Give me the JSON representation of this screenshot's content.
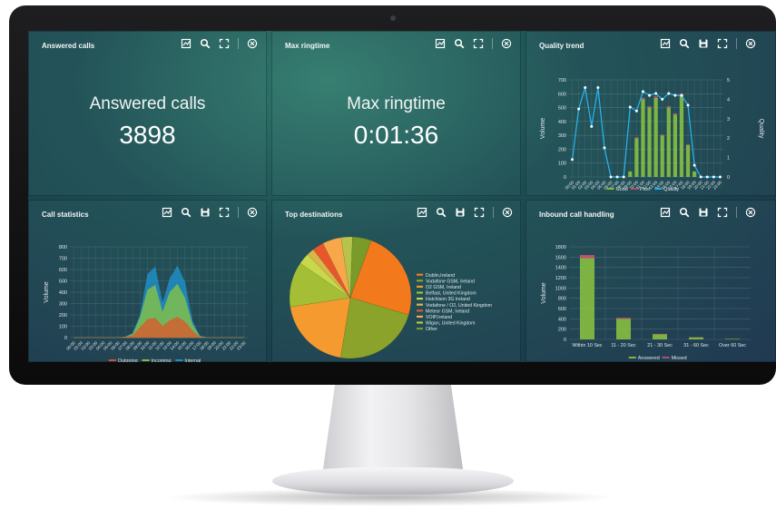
{
  "dashboard": {
    "answered": {
      "title": "Answered calls",
      "label": "Answered calls",
      "value": "3898"
    },
    "ringtime": {
      "title": "Max ringtime",
      "label": "Max ringtime",
      "value": "0:01:36"
    },
    "quality": {
      "title": "Quality trend"
    },
    "callstats": {
      "title": "Call statistics"
    },
    "destinations": {
      "title": "Top destinations"
    },
    "inbound": {
      "title": "Inbound call handling"
    }
  },
  "icons": {
    "chart": "chart-type-icon",
    "search": "search-icon",
    "save": "save-icon",
    "expand": "expand-icon",
    "close": "close-circle-icon"
  },
  "colors": {
    "good": "#8dc63f",
    "poor": "#c0506f",
    "quality": "#29b6f6",
    "outgoing": "#e0552a",
    "incoming": "#8dc63f",
    "internal": "#1f97d4",
    "answered": "#8dc63f",
    "missed": "#c0506f"
  },
  "chart_data": [
    {
      "type": "bar",
      "title": "Quality trend",
      "ylabel": "Volume",
      "y2label": "Quality",
      "ylim": [
        0,
        700
      ],
      "y2lim": [
        0,
        5
      ],
      "yticks": [
        "700",
        "600",
        "500",
        "400",
        "300",
        "200",
        "100",
        "0"
      ],
      "y2ticks": [
        "5",
        "4",
        "3",
        "2",
        "1",
        "0"
      ],
      "categories": [
        "00:00",
        "01:00",
        "02:00",
        "03:00",
        "04:00",
        "05:00",
        "06:00",
        "07:00",
        "08:00",
        "09:00",
        "10:00",
        "11:00",
        "12:00",
        "13:00",
        "14:00",
        "15:00",
        "16:00",
        "17:00",
        "18:00",
        "19:00",
        "20:00",
        "21:00",
        "22:00",
        "23:00"
      ],
      "series": [
        {
          "name": "Good",
          "type": "bar",
          "values": [
            0,
            0,
            0,
            0,
            0,
            0,
            0,
            0,
            0,
            40,
            280,
            560,
            500,
            570,
            300,
            500,
            450,
            590,
            230,
            40,
            0,
            0,
            0,
            0
          ]
        },
        {
          "name": "Poor",
          "type": "bar",
          "values": [
            0,
            0,
            0,
            0,
            0,
            0,
            0,
            0,
            0,
            0,
            5,
            10,
            10,
            12,
            5,
            10,
            8,
            12,
            5,
            0,
            0,
            0,
            0,
            0
          ]
        },
        {
          "name": "Quality",
          "type": "line",
          "values": [
            0.9,
            3.5,
            4.6,
            2.6,
            4.6,
            1.5,
            0,
            0,
            0,
            3.6,
            3.4,
            4.4,
            4.2,
            4.3,
            4.0,
            4.3,
            4.2,
            4.2,
            3.7,
            0.6,
            0,
            0,
            0,
            0
          ]
        }
      ],
      "legend": "bottom"
    },
    {
      "type": "area",
      "title": "Call statistics",
      "ylabel": "Volume",
      "ylim": [
        0,
        800
      ],
      "yticks": [
        "800",
        "700",
        "600",
        "500",
        "400",
        "300",
        "200",
        "100",
        "0"
      ],
      "categories": [
        "00:00",
        "01:00",
        "02:00",
        "03:00",
        "04:00",
        "05:00",
        "06:00",
        "07:00",
        "08:00",
        "09:00",
        "10:00",
        "11:00",
        "12:00",
        "13:00",
        "14:00",
        "15:00",
        "16:00",
        "17:00",
        "18:00",
        "19:00",
        "20:00",
        "21:00",
        "22:00",
        "23:00"
      ],
      "series": [
        {
          "name": "Internal",
          "values": [
            0,
            0,
            0,
            0,
            0,
            0,
            0,
            5,
            40,
            200,
            560,
            620,
            300,
            520,
            630,
            490,
            150,
            15,
            0,
            0,
            0,
            0,
            0,
            0
          ]
        },
        {
          "name": "Incoming",
          "values": [
            0,
            0,
            0,
            0,
            0,
            0,
            0,
            5,
            30,
            180,
            420,
            460,
            220,
            400,
            470,
            350,
            120,
            10,
            0,
            0,
            0,
            0,
            0,
            0
          ]
        },
        {
          "name": "Outgoing",
          "values": [
            0,
            0,
            0,
            0,
            0,
            0,
            0,
            2,
            20,
            90,
            160,
            170,
            100,
            150,
            180,
            140,
            60,
            5,
            0,
            0,
            0,
            0,
            0,
            0
          ]
        }
      ],
      "legend": "bottom"
    },
    {
      "type": "pie",
      "title": "Top destinations",
      "labels": [
        "Dublin,Ireland",
        "Vodafone GSM, Ireland",
        "O2 GSM, Ireland",
        "Belfast, United Kingdom",
        "Hutchison 3G Ireland",
        "Vodafone / O2, United Kingdom",
        "Meteor GSM, Ireland",
        "VOIP,Ireland",
        "Wigan, United Kingdom",
        "Other"
      ],
      "values": [
        24,
        23,
        20,
        12,
        3,
        2,
        3,
        5,
        3,
        5
      ],
      "colors": [
        "#f27a1c",
        "#8ba32a",
        "#f49a2e",
        "#a4be35",
        "#c8d84a",
        "#d9b64a",
        "#e8572a",
        "#f6a84a",
        "#b7c44a",
        "#7a9a2a"
      ],
      "legend": "right"
    },
    {
      "type": "bar",
      "title": "Inbound call handling",
      "ylabel": "Volume",
      "ylim": [
        0,
        1800
      ],
      "yticks": [
        "1800",
        "1600",
        "1400",
        "1200",
        "1000",
        "800",
        "600",
        "400",
        "200",
        "0"
      ],
      "categories": [
        "Within 10 Sec",
        "11 - 20 Sec",
        "21 - 30 Sec",
        "31 - 60 Sec",
        "Over 60 Sec"
      ],
      "series": [
        {
          "name": "Answered",
          "values": [
            1580,
            400,
            100,
            40,
            10
          ]
        },
        {
          "name": "Missed",
          "values": [
            60,
            20,
            8,
            5,
            2
          ]
        }
      ],
      "legend": "bottom"
    }
  ]
}
